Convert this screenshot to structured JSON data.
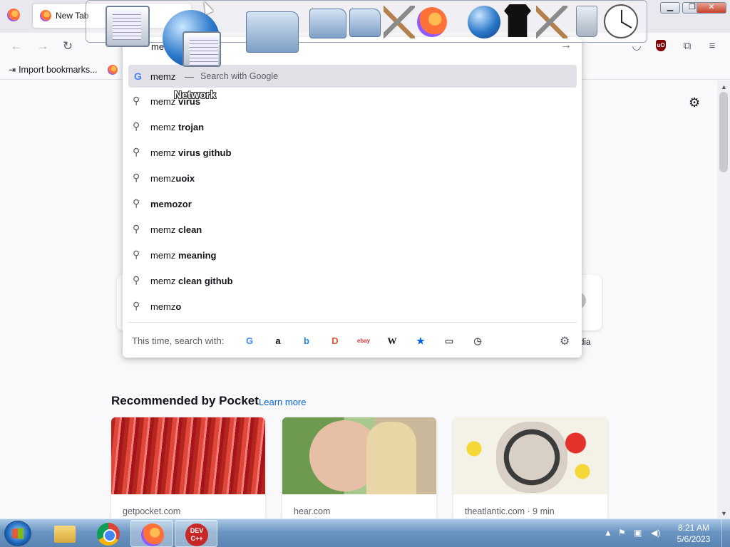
{
  "tabs": [
    {
      "label": "New Tab"
    }
  ],
  "window_controls": {
    "minimize": "▁",
    "restore": "❐",
    "close": "✕"
  },
  "nav": {
    "back_icon": "←",
    "forward_icon": "→",
    "reload_icon": "↻"
  },
  "bookmarks": {
    "import_label": "Import bookmarks..."
  },
  "urlbar": {
    "typed_text": "mer",
    "go_icon": "→",
    "first_suggestion": {
      "term": "memz",
      "separator": "—",
      "action": "Search with Google"
    },
    "suggestions": [
      {
        "prefix": "memz ",
        "bold": "virus"
      },
      {
        "prefix": "memz ",
        "bold": "trojan"
      },
      {
        "prefix": "memz ",
        "bold": "virus github"
      },
      {
        "prefix": "memz",
        "bold": "uoix"
      },
      {
        "prefix": "",
        "bold": "memozor"
      },
      {
        "prefix": "memz ",
        "bold": "clean"
      },
      {
        "prefix": "memz ",
        "bold": "meaning"
      },
      {
        "prefix": "memz ",
        "bold": "clean github"
      },
      {
        "prefix": "memz",
        "bold": "o"
      }
    ],
    "one_off_label": "This time, search with:",
    "engines": [
      {
        "name": "google",
        "glyph": "G",
        "color": "#4285f4"
      },
      {
        "name": "amazon",
        "glyph": "a",
        "color": "#111111"
      },
      {
        "name": "bing",
        "glyph": "b",
        "color": "#1e88e5"
      },
      {
        "name": "duckduckgo",
        "glyph": "D",
        "color": "#de5833"
      },
      {
        "name": "ebay",
        "glyph": "ebay",
        "color": "#e53238"
      },
      {
        "name": "wikipedia",
        "glyph": "W",
        "color": "#111111"
      },
      {
        "name": "bookmarks",
        "glyph": "★",
        "color": "#0061e0"
      },
      {
        "name": "tabs",
        "glyph": "▭",
        "color": "#5b5b66"
      },
      {
        "name": "history",
        "glyph": "◷",
        "color": "#5b5b66"
      }
    ]
  },
  "swarm": {
    "network_label": "Network"
  },
  "newtab": {
    "shortcut_partial_label": "dia",
    "pocket_title": "Recommended by Pocket",
    "pocket_learn_more": "Learn more",
    "pocket_cards": [
      {
        "source": "getpocket.com"
      },
      {
        "source": "hear.com"
      },
      {
        "source": "theatlantic.com · 9 min"
      }
    ]
  },
  "taskbar": {
    "time": "8:21 AM",
    "date": "5/6/2023",
    "dev_label": "DEV C++"
  }
}
